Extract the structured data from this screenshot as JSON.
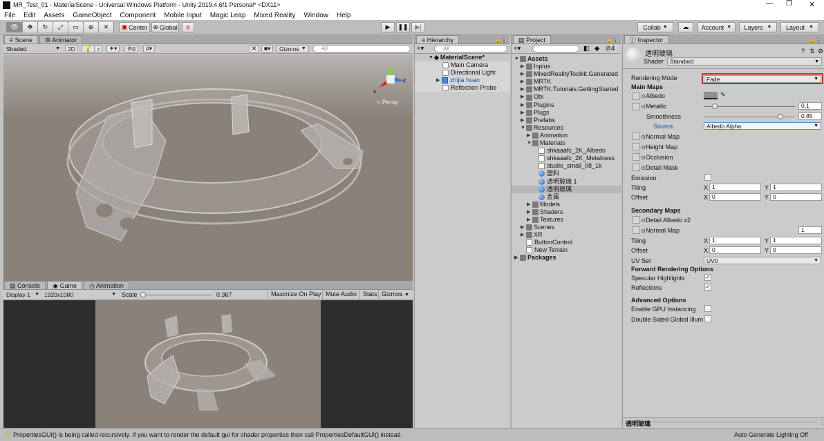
{
  "window": {
    "title": "MR_Test_01 - MaterialScene - Universal Windows Platform - Unity 2019.4.6f1 Personal* <DX11>"
  },
  "menu": [
    "File",
    "Edit",
    "Assets",
    "GameObject",
    "Component",
    "Mobile Input",
    "Magic Leap",
    "Mixed Reality",
    "Window",
    "Help"
  ],
  "toolbar": {
    "center": "Center",
    "global": "Global",
    "collab": "Collab",
    "account": "Account",
    "layers": "Layers",
    "layout": "Layout"
  },
  "scene": {
    "tabs": [
      "Scene",
      "Animator"
    ],
    "shading": "Shaded",
    "mode_2d": "2D",
    "hidden_count": "0",
    "gizmos": "Gizmos",
    "search_placeholder": "All",
    "persp": "< Persp",
    "axis_x": "x",
    "axis_z": "z"
  },
  "game": {
    "tabs": [
      "Console",
      "Game",
      "Animation"
    ],
    "display": "Display 1",
    "resolution": "1920x1080",
    "scale_label": "Scale",
    "scale_value": "0.367",
    "maximize": "Maximize On Play",
    "mute": "Mute Audio",
    "stats": "Stats",
    "gizmos": "Gizmos"
  },
  "hierarchy": {
    "tab": "Hierarchy",
    "search_placeholder": "All",
    "scene": "MaterialScene*",
    "items": [
      "Main Camera",
      "Directional Light",
      "zhijia huan",
      "Reflection Probe"
    ]
  },
  "project": {
    "tab": "Project",
    "count": "4",
    "items": [
      {
        "t": "Assets",
        "d": 0,
        "k": "folder",
        "b": true
      },
      {
        "t": "Inplus",
        "d": 1,
        "k": "folder"
      },
      {
        "t": "MixedRealityToolkit.Generated",
        "d": 1,
        "k": "folder"
      },
      {
        "t": "MRTK",
        "d": 1,
        "k": "folder"
      },
      {
        "t": "MRTK.Tutorials.GettingStarted",
        "d": 1,
        "k": "folder"
      },
      {
        "t": "Obi",
        "d": 1,
        "k": "folder"
      },
      {
        "t": "Plugins",
        "d": 1,
        "k": "folder"
      },
      {
        "t": "Plugs",
        "d": 1,
        "k": "folder"
      },
      {
        "t": "Prefabs",
        "d": 1,
        "k": "folder"
      },
      {
        "t": "Resources",
        "d": 1,
        "k": "folder"
      },
      {
        "t": "Animation",
        "d": 2,
        "k": "folder"
      },
      {
        "t": "Materials",
        "d": 2,
        "k": "folder"
      },
      {
        "t": "shkaaafc_2K_Albedo",
        "d": 3,
        "k": "file"
      },
      {
        "t": "shkaaafc_2K_Metalness",
        "d": 3,
        "k": "file"
      },
      {
        "t": "studio_small_08_1k",
        "d": 3,
        "k": "file"
      },
      {
        "t": "塑料",
        "d": 3,
        "k": "mat"
      },
      {
        "t": "透明玻璃 1",
        "d": 3,
        "k": "mat"
      },
      {
        "t": "透明玻璃",
        "d": 3,
        "k": "mat",
        "sel": true
      },
      {
        "t": "金属",
        "d": 3,
        "k": "mat"
      },
      {
        "t": "Models",
        "d": 2,
        "k": "folder"
      },
      {
        "t": "Shaders",
        "d": 2,
        "k": "folder"
      },
      {
        "t": "Textures",
        "d": 2,
        "k": "folder"
      },
      {
        "t": "Scenes",
        "d": 1,
        "k": "folder"
      },
      {
        "t": "XR",
        "d": 1,
        "k": "folder"
      },
      {
        "t": "ButtonControl",
        "d": 1,
        "k": "file"
      },
      {
        "t": "New Terrain",
        "d": 1,
        "k": "file"
      },
      {
        "t": "Packages",
        "d": 0,
        "k": "folder",
        "b": true
      }
    ]
  },
  "inspector": {
    "tab": "Inspector",
    "material": "透明玻璃",
    "shader_label": "Shader",
    "shader": "Standard",
    "rendering_mode_label": "Rendering Mode",
    "rendering_mode": "Fade",
    "main_maps": "Main Maps",
    "albedo": "Albedo",
    "metallic": "Metallic",
    "metallic_value": "0.1",
    "smoothness": "Smoothness",
    "smoothness_value": "0.85",
    "source": "Source",
    "source_value": "Albedo Alpha",
    "normal_map": "Normal Map",
    "height_map": "Height Map",
    "occlusion": "Occlusion",
    "detail_mask": "Detail Mask",
    "emission": "Emission",
    "tiling": "Tiling",
    "offset": "Offset",
    "x": "X",
    "y": "Y",
    "one": "1",
    "zero": "0",
    "secondary_maps": "Secondary Maps",
    "detail_albedo": "Detail Albedo x2",
    "normal_map2": "Normal Map",
    "normal_value": "1",
    "uv_set": "UV Set",
    "uv_value": "UV0",
    "forward": "Forward Rendering Options",
    "specular": "Specular Highlights",
    "reflections": "Reflections",
    "advanced": "Advanced Options",
    "gpu": "Enable GPU Instancing",
    "double_sided": "Double Sided Global Illum",
    "footer": "透明玻璃",
    "auto_generate": "Auto Generate Lighting Off"
  },
  "status": {
    "message": "PropertiesGUI() is being called recursively. If you want to render the default gui for shader properties then call PropertiesDefaultGUI() instead"
  },
  "colors": {
    "accent": "#e0201c",
    "selection": "#b7b7b7",
    "scene_bg": "#8a8178"
  }
}
